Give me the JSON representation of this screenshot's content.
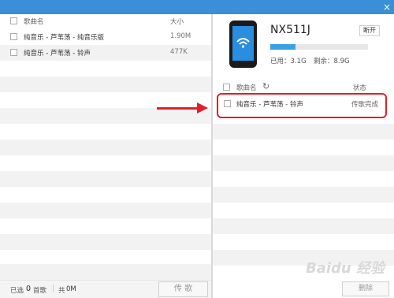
{
  "window": {
    "close_glyph": "×"
  },
  "left_panel": {
    "header": {
      "name_col": "歌曲名",
      "size_col": "大小"
    },
    "rows": [
      {
        "name": "纯音乐 - 芦苇荡 - 纯音乐版",
        "size": "1.90M"
      },
      {
        "name": "纯音乐 - 芦苇荡 - 铃声",
        "size": "477K"
      }
    ],
    "footer": {
      "selected_prefix": "已选",
      "selected_count": "0",
      "selected_suffix": "首歌",
      "total_prefix": "共",
      "total_value": "0M",
      "transfer_button": "传 歌"
    }
  },
  "right_panel": {
    "device_name": "NX511J",
    "disconnect_button": "断开",
    "used_label": "已用：3.1G",
    "free_label": "剩余：8.9G",
    "storage_used_fraction": 0.26,
    "header": {
      "name_col": "歌曲名",
      "status_col": "状态"
    },
    "rows": [
      {
        "name": "纯音乐 - 芦苇荡 - 铃声",
        "status": "传歌完成"
      }
    ],
    "delete_button": "删除"
  },
  "watermark": "Baidu 经验"
}
